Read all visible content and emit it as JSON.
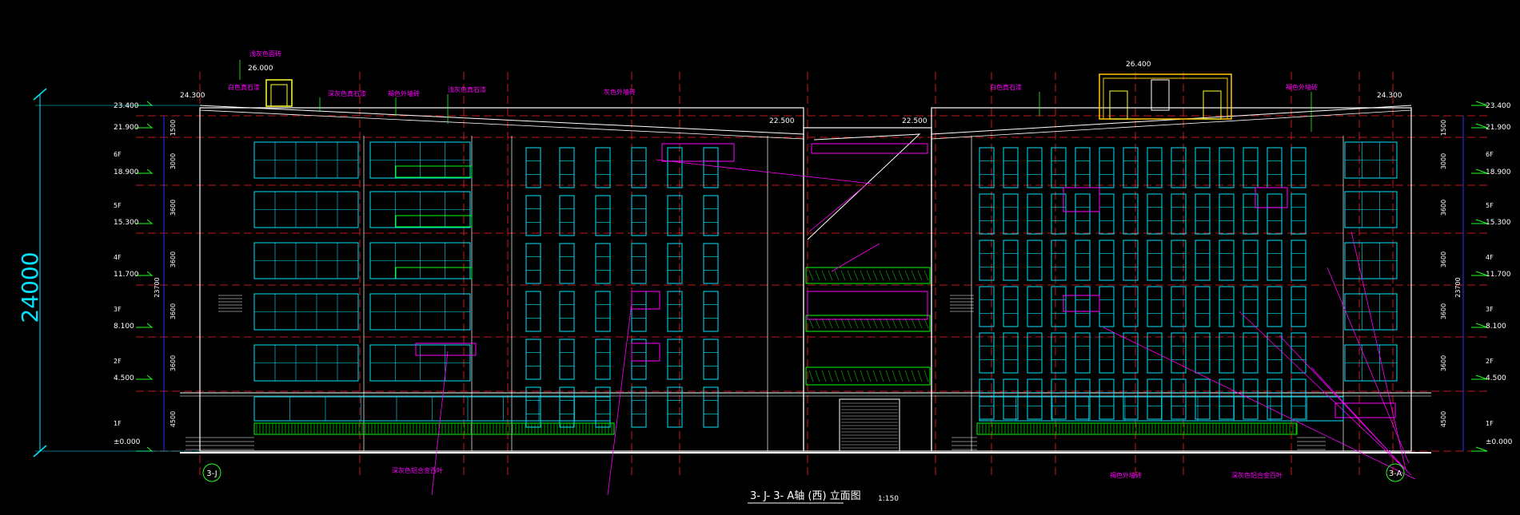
{
  "drawing": {
    "title": "3- J- 3- A轴 (西) 立面图",
    "scale": "1:150",
    "overall_height_dim": "24000",
    "sub_height_dim": "23700",
    "axis_left": "3-J",
    "axis_right": "3-A",
    "colors": {
      "background": "#000000",
      "structure": "#ffffff",
      "window": "#00e5ff",
      "grid_line": "#ff2020",
      "annotation": "#ff00ff",
      "leader": "#20ff20",
      "dim": "#3030ff",
      "railing": "#00ff00",
      "elev_text": "#ffffff"
    }
  },
  "elevations_left": [
    {
      "label": "23.400"
    },
    {
      "label": "21.900"
    },
    {
      "label": "6F"
    },
    {
      "label": "18.900"
    },
    {
      "label": "5F"
    },
    {
      "label": "15.300"
    },
    {
      "label": "4F"
    },
    {
      "label": "11.700"
    },
    {
      "label": "3F"
    },
    {
      "label": "8.100"
    },
    {
      "label": "2F"
    },
    {
      "label": "4.500"
    },
    {
      "label": "1F"
    },
    {
      "label": "±0.000"
    }
  ],
  "elevations_right": [
    {
      "label": "23.400"
    },
    {
      "label": "21.900"
    },
    {
      "label": "6F"
    },
    {
      "label": "18.900"
    },
    {
      "label": "5F"
    },
    {
      "label": "15.300"
    },
    {
      "label": "4F"
    },
    {
      "label": "11.700"
    },
    {
      "label": "3F"
    },
    {
      "label": "8.100"
    },
    {
      "label": "2F"
    },
    {
      "label": "4.500"
    },
    {
      "label": "1F"
    },
    {
      "label": "±0.000"
    }
  ],
  "floor_dims": [
    "1500",
    "3000",
    "3600",
    "3600",
    "3600",
    "3600",
    "4500"
  ],
  "top_marks": [
    "24.300",
    "26.000",
    "22.500",
    "22.500",
    "26.400",
    "24.300"
  ],
  "notes": [
    "浅灰色面砖",
    "白色真石漆",
    "深灰色真石漆",
    "褐色外墙砖",
    "浅灰色真石漆",
    "白色真石漆",
    "褐色外墙砖",
    "灰色外墙砖",
    "深灰色铝合金百叶",
    "褐色外墙砖",
    "深灰色铝合金百叶"
  ]
}
